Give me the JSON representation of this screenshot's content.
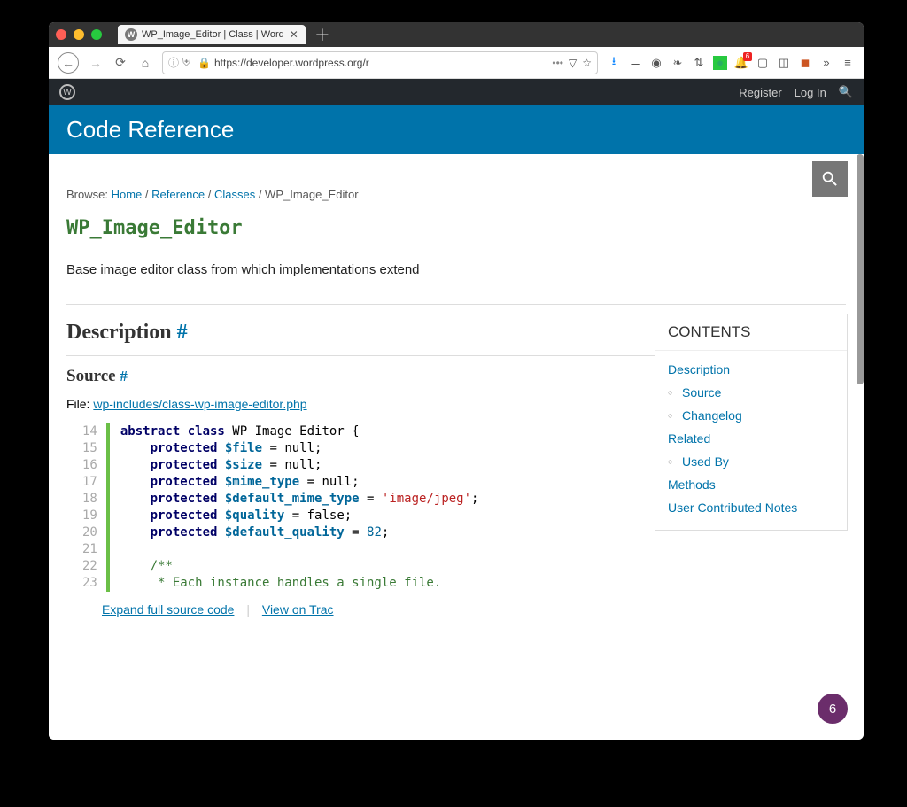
{
  "tab": {
    "title": "WP_Image_Editor | Class | Word"
  },
  "url": {
    "display": "https://developer.wordpress.org/r"
  },
  "wpAdmin": {
    "register": "Register",
    "login": "Log In"
  },
  "header": {
    "title": "Code Reference"
  },
  "breadcrumb": {
    "prefix": "Browse:",
    "items": [
      "Home",
      "Reference",
      "Classes"
    ],
    "current": "WP_Image_Editor"
  },
  "page": {
    "title": "WP_Image_Editor",
    "summary": "Base image editor class from which implementations extend"
  },
  "sections": {
    "description": "Description",
    "source": "Source"
  },
  "source": {
    "fileLabel": "File:",
    "filePath": "wp-includes/class-wp-image-editor.php",
    "startLine": 14,
    "lines": [
      [
        {
          "t": "abstract class",
          "c": "kw"
        },
        {
          "t": " WP_Image_Editor {",
          "c": ""
        }
      ],
      [
        {
          "t": "    ",
          "c": ""
        },
        {
          "t": "protected",
          "c": "kw"
        },
        {
          "t": " ",
          "c": ""
        },
        {
          "t": "$file",
          "c": "var"
        },
        {
          "t": " = null;",
          "c": ""
        }
      ],
      [
        {
          "t": "    ",
          "c": ""
        },
        {
          "t": "protected",
          "c": "kw"
        },
        {
          "t": " ",
          "c": ""
        },
        {
          "t": "$size",
          "c": "var"
        },
        {
          "t": " = null;",
          "c": ""
        }
      ],
      [
        {
          "t": "    ",
          "c": ""
        },
        {
          "t": "protected",
          "c": "kw"
        },
        {
          "t": " ",
          "c": ""
        },
        {
          "t": "$mime_type",
          "c": "var"
        },
        {
          "t": " = null;",
          "c": ""
        }
      ],
      [
        {
          "t": "    ",
          "c": ""
        },
        {
          "t": "protected",
          "c": "kw"
        },
        {
          "t": " ",
          "c": ""
        },
        {
          "t": "$default_mime_type",
          "c": "var"
        },
        {
          "t": " = ",
          "c": ""
        },
        {
          "t": "'image/jpeg'",
          "c": "str"
        },
        {
          "t": ";",
          "c": ""
        }
      ],
      [
        {
          "t": "    ",
          "c": ""
        },
        {
          "t": "protected",
          "c": "kw"
        },
        {
          "t": " ",
          "c": ""
        },
        {
          "t": "$quality",
          "c": "var"
        },
        {
          "t": " = false;",
          "c": ""
        }
      ],
      [
        {
          "t": "    ",
          "c": ""
        },
        {
          "t": "protected",
          "c": "kw"
        },
        {
          "t": " ",
          "c": ""
        },
        {
          "t": "$default_quality",
          "c": "var"
        },
        {
          "t": " = ",
          "c": ""
        },
        {
          "t": "82",
          "c": "num"
        },
        {
          "t": ";",
          "c": ""
        }
      ],
      [
        {
          "t": "",
          "c": ""
        }
      ],
      [
        {
          "t": "    ",
          "c": ""
        },
        {
          "t": "/**",
          "c": "cm"
        }
      ],
      [
        {
          "t": "     * Each instance handles a single file.",
          "c": "cm"
        }
      ]
    ],
    "expand": "Expand full source code",
    "viewTrac": "View on Trac"
  },
  "toc": {
    "title": "CONTENTS",
    "items": [
      {
        "label": "Description",
        "sub": false
      },
      {
        "label": "Source",
        "sub": true
      },
      {
        "label": "Changelog",
        "sub": true
      },
      {
        "label": "Related",
        "sub": false
      },
      {
        "label": "Used By",
        "sub": true
      },
      {
        "label": "Methods",
        "sub": false
      },
      {
        "label": "User Contributed Notes",
        "sub": false
      }
    ]
  },
  "counter": "6",
  "toolbar": {
    "notifBadge": "6"
  }
}
